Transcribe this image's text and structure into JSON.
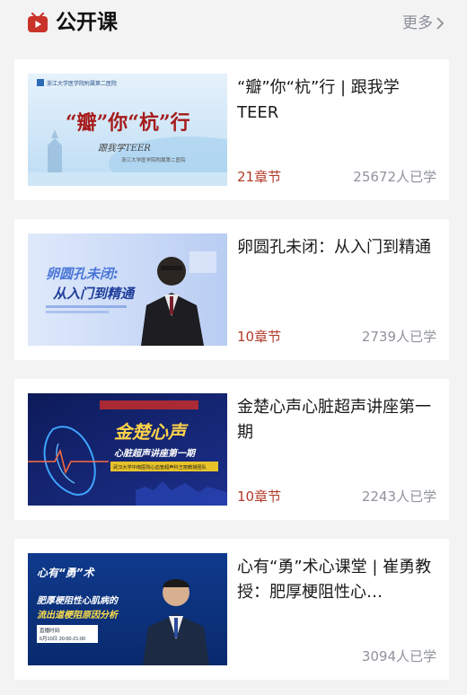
{
  "header": {
    "title": "公开课",
    "more_label": "更多",
    "icon": "video-play-icon",
    "accent": "#c9332a"
  },
  "courses": [
    {
      "title": "“瓣”你“杭”行 | 跟我学TEER",
      "chapters": "21章节",
      "learners": "25672人已学",
      "thumb": {
        "top_text": "浙江大学医学院附属第二医院",
        "main_text": "“瓣”你“杭”行",
        "sub_text": "跟我学TEER",
        "foot_text": "浙江大学医学院附属第二医院"
      }
    },
    {
      "title": "卵圆孔未闭：从入门到精通",
      "chapters": "10章节",
      "learners": "2739人已学",
      "thumb": {
        "line1": "卵圆孔未闭:",
        "line2": "从入门到精通"
      }
    },
    {
      "title": "金楚心声心脏超声讲座第一期",
      "chapters": "10章节",
      "learners": "2243人已学",
      "thumb": {
        "main_text": "金楚心声",
        "sub_text": "心脏超声讲座第一期",
        "band_text": "武汉大学中南医院心血管超声科王丽教授团队"
      }
    },
    {
      "title": "心有“勇”术心课堂 | 崔勇教授：肥厚梗阻性心…",
      "chapters": "",
      "learners": "3094人已学",
      "thumb": {
        "brand": "心有“勇”术",
        "line1": "肥厚梗阻性心肌病的",
        "line2": "流出道梗阻原因分析",
        "time_label": "直播时间:",
        "time_value": "6月10日 20:00-21:00"
      }
    }
  ]
}
